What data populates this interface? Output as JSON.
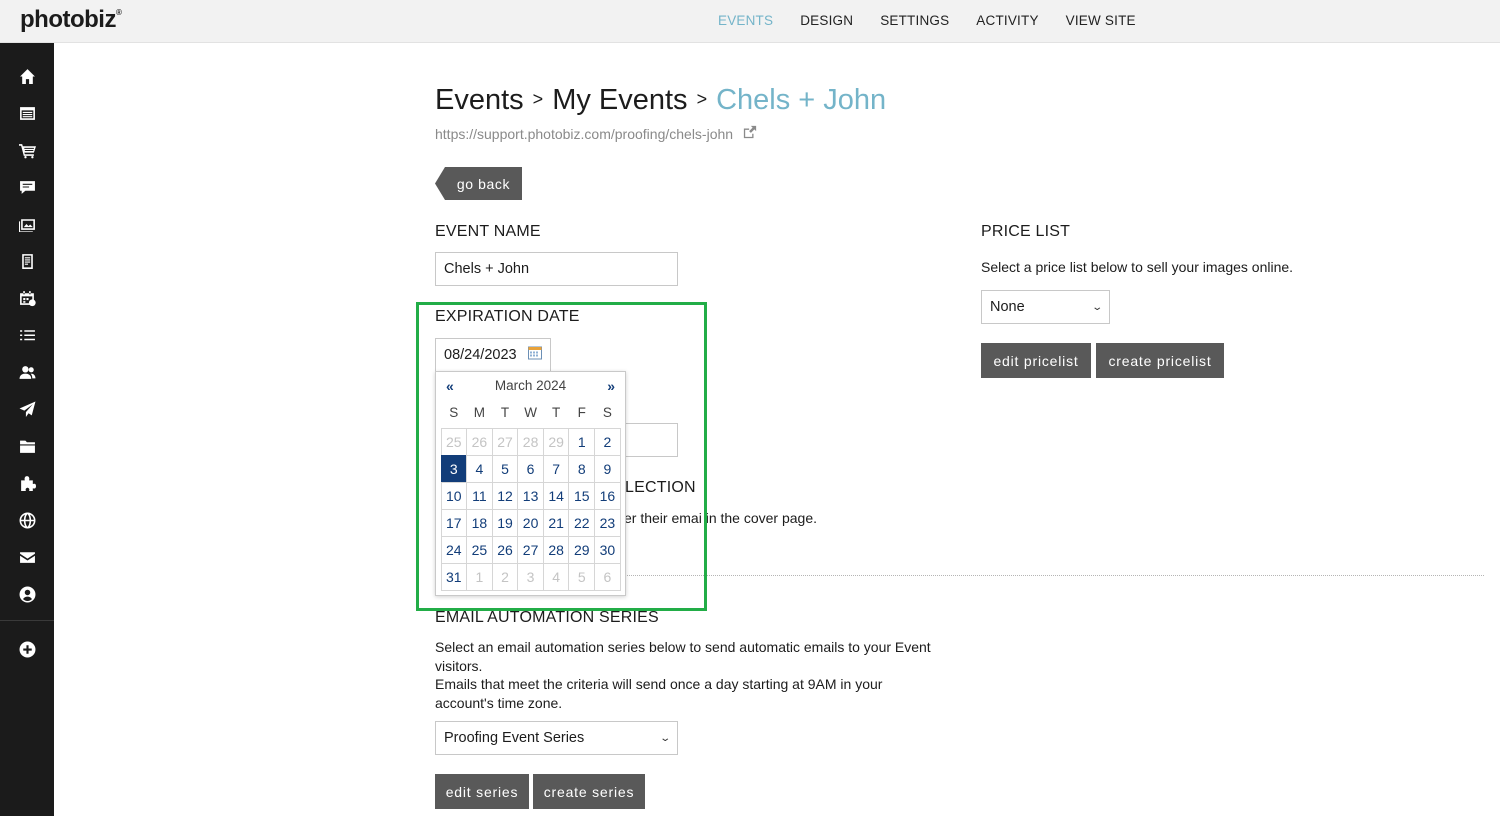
{
  "brand": {
    "logo_text": "photobiz",
    "logo_mark": "®"
  },
  "topnav": [
    {
      "label": "EVENTS",
      "active": true
    },
    {
      "label": "DESIGN",
      "active": false
    },
    {
      "label": "SETTINGS",
      "active": false
    },
    {
      "label": "ACTIVITY",
      "active": false
    },
    {
      "label": "VIEW SITE",
      "active": false
    }
  ],
  "sidebar": {
    "icons": [
      "home-icon",
      "pages-icon",
      "cart-icon",
      "chat-icon",
      "gallery-icon",
      "document-icon",
      "calendar-icon",
      "list-icon",
      "users-icon",
      "send-icon",
      "folder-icon",
      "puzzle-icon",
      "globe-icon",
      "mail-icon",
      "account-icon",
      "add-icon"
    ]
  },
  "breadcrumb": {
    "item1": "Events",
    "sep": ">",
    "item2": "My Events",
    "current": "Chels + John"
  },
  "event_url": "https://support.photobiz.com/proofing/chels-john",
  "go_back_label": "go back",
  "event_name": {
    "label": "EVENT NAME",
    "value": "Chels + John"
  },
  "expiration": {
    "label": "EXPIRATION DATE",
    "value": "08/24/2023"
  },
  "email_collection": {
    "label_partial": "LECTION",
    "desc_partial_a": "er their emai",
    "desc_partial_b": " in the cover page."
  },
  "price_list": {
    "label": "PRICE LIST",
    "description": "Select a price list below to sell your images online.",
    "selected": "None",
    "edit_label": "edit pricelist",
    "create_label": "create pricelist"
  },
  "email_automation": {
    "label": "EMAIL AUTOMATION SERIES",
    "desc_line1": "Select an email automation series below to send automatic emails to your Event",
    "desc_line2": "visitors.",
    "desc_line3": "Emails that meet the criteria will send once a day starting at 9AM in your",
    "desc_line4": "account's time zone.",
    "selected": "Proofing Event Series",
    "edit_label": "edit series",
    "create_label": "create series"
  },
  "calendar": {
    "prev": "«",
    "next": "»",
    "title": "March 2024",
    "dows": [
      "S",
      "M",
      "T",
      "W",
      "T",
      "F",
      "S"
    ],
    "selected_day": "3",
    "weeks": [
      [
        [
          "25",
          true
        ],
        [
          "26",
          true
        ],
        [
          "27",
          true
        ],
        [
          "28",
          true
        ],
        [
          "29",
          true
        ],
        [
          "1",
          false
        ],
        [
          "2",
          false
        ]
      ],
      [
        [
          "3",
          false
        ],
        [
          "4",
          false
        ],
        [
          "5",
          false
        ],
        [
          "6",
          false
        ],
        [
          "7",
          false
        ],
        [
          "8",
          false
        ],
        [
          "9",
          false
        ]
      ],
      [
        [
          "10",
          false
        ],
        [
          "11",
          false
        ],
        [
          "12",
          false
        ],
        [
          "13",
          false
        ],
        [
          "14",
          false
        ],
        [
          "15",
          false
        ],
        [
          "16",
          false
        ]
      ],
      [
        [
          "17",
          false
        ],
        [
          "18",
          false
        ],
        [
          "19",
          false
        ],
        [
          "20",
          false
        ],
        [
          "21",
          false
        ],
        [
          "22",
          false
        ],
        [
          "23",
          false
        ]
      ],
      [
        [
          "24",
          false
        ],
        [
          "25",
          false
        ],
        [
          "26",
          false
        ],
        [
          "27",
          false
        ],
        [
          "28",
          false
        ],
        [
          "29",
          false
        ],
        [
          "30",
          false
        ]
      ],
      [
        [
          "31",
          false
        ],
        [
          "1",
          true
        ],
        [
          "2",
          true
        ],
        [
          "3",
          true
        ],
        [
          "4",
          true
        ],
        [
          "5",
          true
        ],
        [
          "6",
          true
        ]
      ]
    ]
  },
  "colors": {
    "accent": "#74b4c9",
    "calendar_blue": "#123d79",
    "highlight_green": "#22ad47",
    "button_gray": "#595959"
  }
}
